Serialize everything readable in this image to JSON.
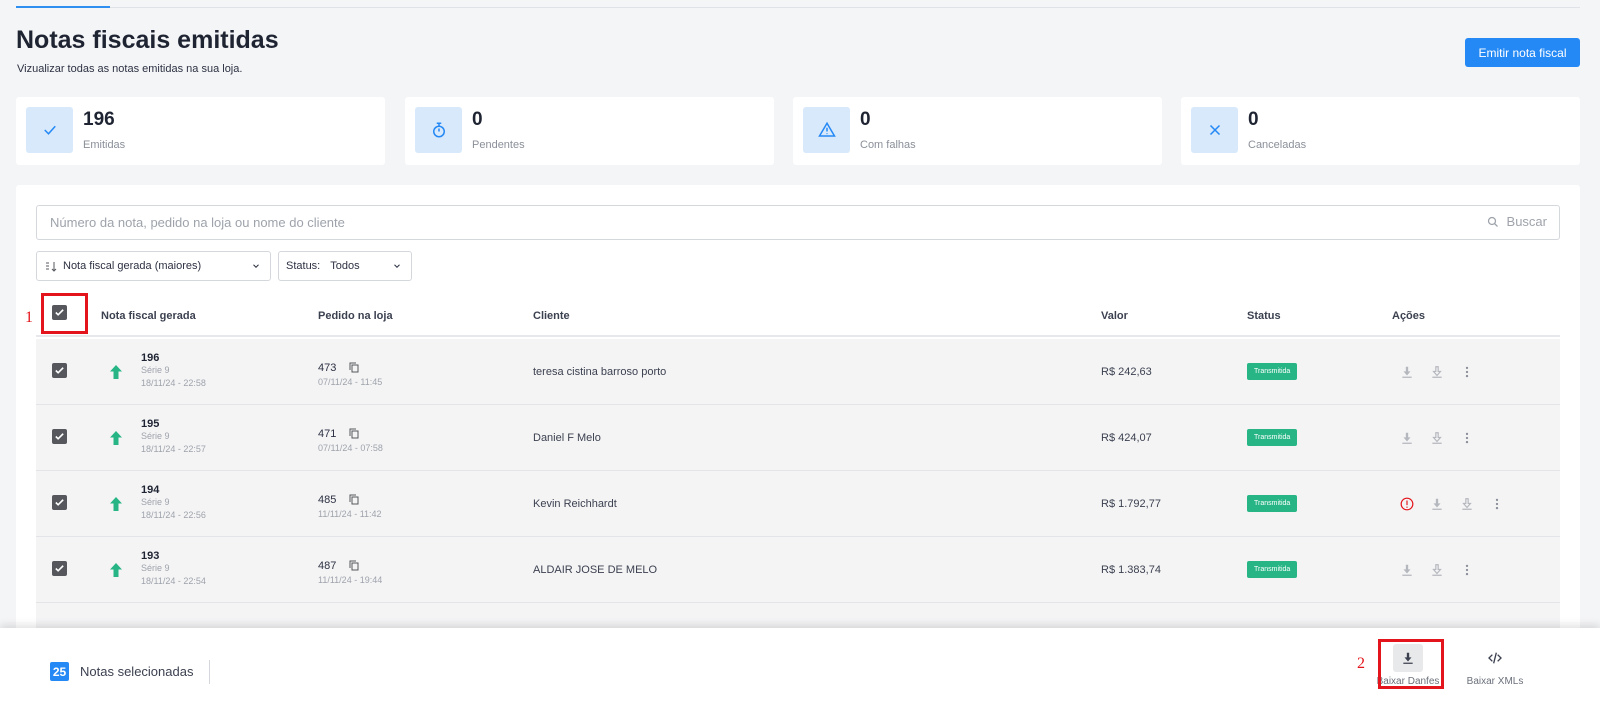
{
  "header": {
    "title": "Notas fiscais emitidas",
    "subtitle": "Vizualizar todas as notas emitidas na sua loja.",
    "emit_button": "Emitir nota fiscal"
  },
  "stats": [
    {
      "value": "196",
      "label": "Emitidas",
      "icon": "check-icon"
    },
    {
      "value": "0",
      "label": "Pendentes",
      "icon": "stopwatch-icon"
    },
    {
      "value": "0",
      "label": "Com falhas",
      "icon": "warning-icon"
    },
    {
      "value": "0",
      "label": "Canceladas",
      "icon": "x-icon"
    }
  ],
  "search": {
    "placeholder": "Número da nota, pedido na loja ou nome do cliente",
    "button": "Buscar"
  },
  "filters": {
    "sort_label": "Nota fiscal gerada (maiores)",
    "status_prefix": "Status:",
    "status_value": "Todos"
  },
  "table": {
    "headers": {
      "note": "Nota fiscal gerada",
      "order": "Pedido na loja",
      "client": "Cliente",
      "value": "Valor",
      "status": "Status",
      "actions": "Ações"
    },
    "rows": [
      {
        "number": "196",
        "series": "Série 9",
        "date": "18/11/24 - 22:58",
        "order": "473",
        "order_date": "07/11/24 - 11:45",
        "client": "teresa cistina barroso porto",
        "value": "R$ 242,63",
        "status": "Transmitida"
      },
      {
        "number": "195",
        "series": "Série 9",
        "date": "18/11/24 - 22:57",
        "order": "471",
        "order_date": "07/11/24 - 07:58",
        "client": "Daniel F Melo",
        "value": "R$ 424,07",
        "status": "Transmitida"
      },
      {
        "number": "194",
        "series": "Série 9",
        "date": "18/11/24 - 22:56",
        "order": "485",
        "order_date": "11/11/24 - 11:42",
        "client": "Kevin Reichhardt",
        "value": "R$ 1.792,77",
        "status": "Transmitida"
      },
      {
        "number": "193",
        "series": "Série 9",
        "date": "18/11/24 - 22:54",
        "order": "487",
        "order_date": "11/11/24 - 19:44",
        "client": "ALDAIR JOSE DE MELO",
        "value": "R$ 1.383,74",
        "status": "Transmitida"
      }
    ]
  },
  "annotations": {
    "marker_1": "1",
    "marker_2": "2",
    "color": "#e3141b"
  },
  "footer": {
    "selected_count": "25",
    "selected_label": "Notas selecionadas",
    "download_pdfs": "Baixar Danfes",
    "download_xmls": "Baixar XMLs"
  },
  "colors": {
    "accent": "#2589f5",
    "status_badge": "#27b586",
    "arrow": "#27b586",
    "error": "#e3141b"
  }
}
